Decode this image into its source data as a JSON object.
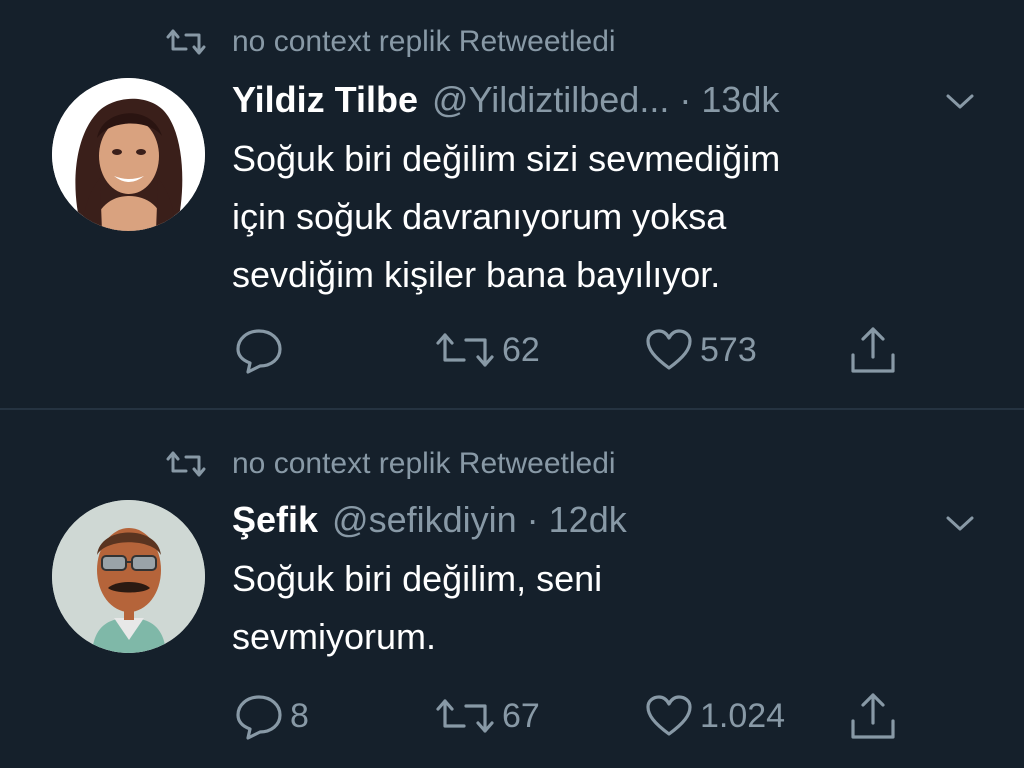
{
  "tweets": [
    {
      "retweet_label": "no context replik Retweetledi",
      "name": "Yildiz Tilbe",
      "handle": "@Yildiztilbed...",
      "time": "· 13dk",
      "lines": [
        "Soğuk biri değilim sizi sevmediğim",
        "için soğuk davranıyorum yoksa",
        "sevdiğim kişiler bana bayılıyor."
      ],
      "reply_count": "",
      "retweet_count": "62",
      "like_count": "573",
      "avatar": "woman-portrait",
      "avatar_bg": "#ffffff"
    },
    {
      "retweet_label": "no context replik Retweetledi",
      "name": "Şefik",
      "handle": "@sefikdiyin",
      "time": "· 12dk",
      "lines": [
        "Soğuk biri değilim, seni",
        "sevmiyorum."
      ],
      "reply_count": "8",
      "retweet_count": "67",
      "like_count": "1.024",
      "avatar": "man-portrait",
      "avatar_bg": "#cfd8d4"
    }
  ],
  "icons": {
    "retweeted_indicator": "retweet-icon",
    "caret": "chevron-down-icon",
    "reply": "reply-icon",
    "retweet": "retweet-icon",
    "like": "heart-icon",
    "share": "share-icon"
  },
  "colors": {
    "background": "#15202b",
    "secondary_text": "#8899a6",
    "divider": "#253341"
  }
}
